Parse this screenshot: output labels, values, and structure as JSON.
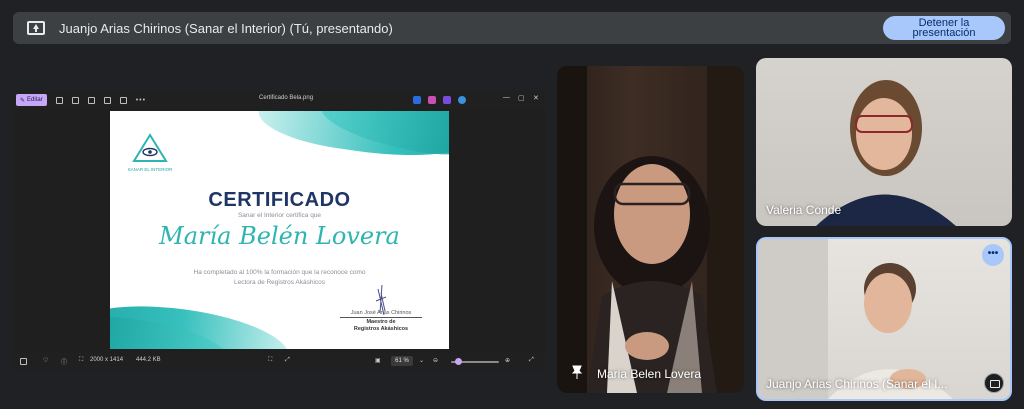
{
  "banner": {
    "text": "Juanjo Arias Chirinos (Sanar el Interior) (Tú, presentando)",
    "stop_button": "Detener la presentación"
  },
  "viewer": {
    "edit_label": "Editar",
    "file_name": "Certificado Bela.png",
    "dimensions": "2000 x 1414",
    "file_size": "444.2 KB",
    "zoom": "61 %"
  },
  "certificate": {
    "logo_text": "SANAR EL INTERIOR",
    "title": "CERTIFICADO",
    "subtitle": "Sanar el Interior certifica que",
    "recipient": "María Belén Lovera",
    "body_line1": "Ha completado al 100% la formación que la reconoce como",
    "body_line2": "Lectora de Registros Akáshicos",
    "signer_name": "Juan José Arias Chirinos",
    "signer_role_line1": "Maestro de",
    "signer_role_line2": "Registros Akáshicos"
  },
  "participants": {
    "maria": {
      "name": "Maria Belen Lovera",
      "icon": "pin-icon"
    },
    "valeria": {
      "name": "Valeria Conde"
    },
    "juanjo": {
      "name": "Juanjo Arias Chirinos (Sanar el I...",
      "more": "•••"
    }
  },
  "colors": {
    "accent": "#a8c7fa",
    "banner_bg": "#3c4043",
    "page_bg": "#202124",
    "teal": "#2db5b2",
    "navy": "#1f3565"
  }
}
